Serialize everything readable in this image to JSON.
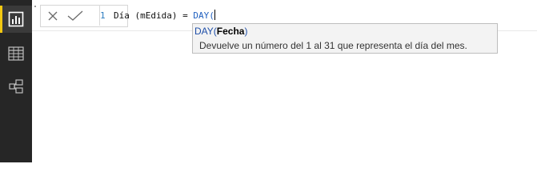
{
  "formula": {
    "line_number": "1",
    "text_before_fn": "Día (mEdida) = ",
    "function_text": "DAY("
  },
  "tooltip": {
    "function_name": "DAY",
    "open_paren": "(",
    "param": "Fecha",
    "close_paren": ")",
    "description": "Devuelve un número del 1 al 31 que representa el día del mes."
  },
  "colors": {
    "sidebar_bg": "#262626",
    "active_indicator": "#f2c811",
    "tooltip_bg": "#f3f3f3",
    "function_blue": "#1f5fbf"
  },
  "icons": [
    "report-view-icon",
    "data-view-icon",
    "model-view-icon",
    "cancel-icon",
    "commit-icon"
  ]
}
